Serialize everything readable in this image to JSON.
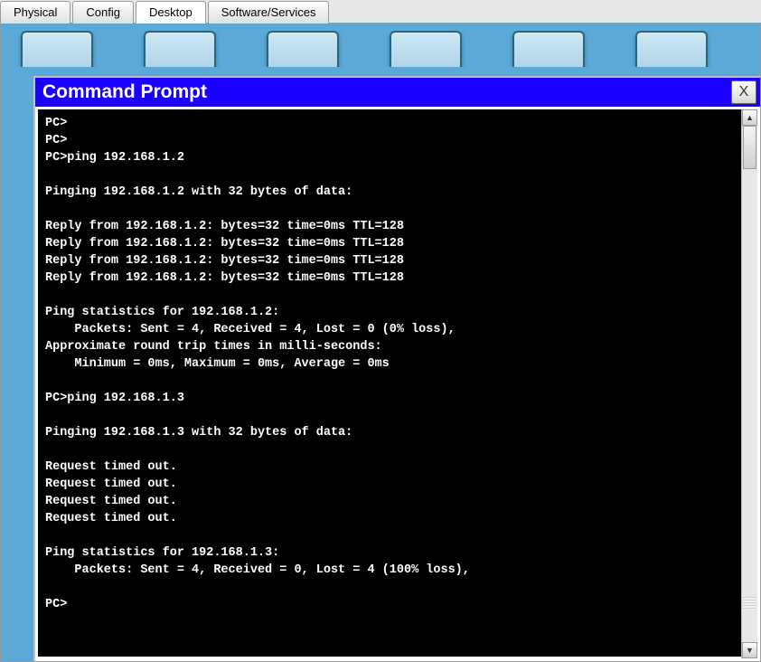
{
  "tabs": [
    {
      "label": "Physical",
      "active": false
    },
    {
      "label": "Config",
      "active": false
    },
    {
      "label": "Desktop",
      "active": true
    },
    {
      "label": "Software/Services",
      "active": false
    }
  ],
  "cmd": {
    "title": "Command Prompt",
    "close": "X",
    "lines": [
      "PC>",
      "PC>",
      "PC>ping 192.168.1.2",
      "",
      "Pinging 192.168.1.2 with 32 bytes of data:",
      "",
      "Reply from 192.168.1.2: bytes=32 time=0ms TTL=128",
      "Reply from 192.168.1.2: bytes=32 time=0ms TTL=128",
      "Reply from 192.168.1.2: bytes=32 time=0ms TTL=128",
      "Reply from 192.168.1.2: bytes=32 time=0ms TTL=128",
      "",
      "Ping statistics for 192.168.1.2:",
      "    Packets: Sent = 4, Received = 4, Lost = 0 (0% loss),",
      "Approximate round trip times in milli-seconds:",
      "    Minimum = 0ms, Maximum = 0ms, Average = 0ms",
      "",
      "PC>ping 192.168.1.3",
      "",
      "Pinging 192.168.1.3 with 32 bytes of data:",
      "",
      "Request timed out.",
      "Request timed out.",
      "Request timed out.",
      "Request timed out.",
      "",
      "Ping statistics for 192.168.1.3:",
      "    Packets: Sent = 4, Received = 0, Lost = 4 (100% loss),",
      "",
      "PC>"
    ]
  },
  "scroll": {
    "up": "▲",
    "down": "▼"
  }
}
